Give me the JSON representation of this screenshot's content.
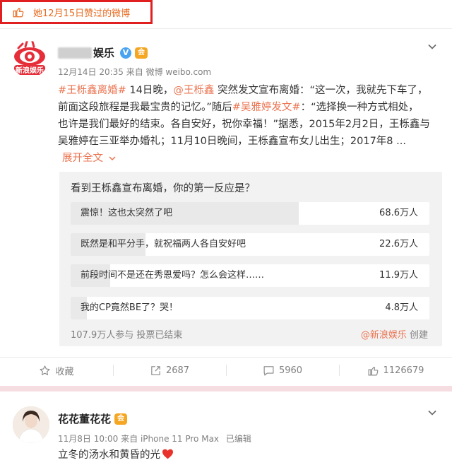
{
  "header": {
    "liked_notice": "她12月15日赞过的微博"
  },
  "post1": {
    "author": "娱乐",
    "verified_badge": "V",
    "vip_badge": "会",
    "avatar_text": "新浪娱乐",
    "date": "12月14日 20:35",
    "source": "来自 微博 weibo.com",
    "text_lines": [
      [
        "#王栎鑫离婚#",
        " 14日晚，",
        "@王栎鑫",
        " 突然发文宣布离婚：“这一次，我就先下车了，"
      ],
      [
        "前面这段旅程是我最宝贵的记忆。”随后",
        "#吴雅婷发文#",
        "：“选择换一种方式相处，"
      ],
      [
        "也许是我们最好的结束。各自安好，祝你幸福！”据悉，2015年2月2日，王栎鑫与"
      ],
      [
        "吴雅婷在三亚举办婚礼；11月10日晚间，王栎鑫宣布女儿出生；2017年8 ..."
      ]
    ],
    "expand_label": "展开全文",
    "expand_icon": "chevron-down-icon"
  },
  "poll": {
    "question": "看到王栎鑫宣布离婚，你的第一反应是？",
    "options": [
      {
        "label": "震惊！这也太突然了吧",
        "count": "68.6万人",
        "share": 0.636
      },
      {
        "label": "既然是和平分手，就祝福两人各自安好吧",
        "count": "22.6万人",
        "share": 0.209
      },
      {
        "label": "前段时间不是还在秀恩爱吗？怎么会这样……",
        "count": "11.9万人",
        "share": 0.11
      },
      {
        "label": "我的CP竟然BE了？哭！",
        "count": "4.8万人",
        "share": 0.045
      }
    ],
    "summary": "107.9万人参与 投票已结束",
    "creator": "@新浪娱乐",
    "creator_suffix": " 创建"
  },
  "actions": {
    "favorite_label": "收藏",
    "repost_count": "2687",
    "comment_count": "5960",
    "like_count": "1126679"
  },
  "post2": {
    "author": "花花董花花",
    "vip_badge": "会",
    "date": "11月8日 10:00",
    "source": "来自 iPhone 11 Pro Max",
    "edited": "已编辑",
    "text": "立冬的汤水和黄昏的光"
  },
  "colors": {
    "accent": "#eb7350",
    "liked_text": "#e86b20",
    "highlight_border": "#e02020",
    "separator": "#f5dde2",
    "verified": "#4aa3f0",
    "vip": "#f5a623"
  }
}
